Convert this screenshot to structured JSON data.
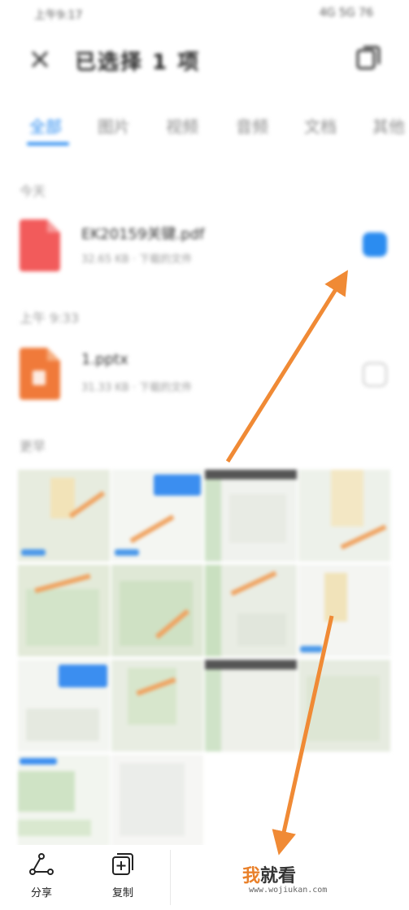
{
  "status_bar": {
    "left": "上午9:17",
    "right": "4G 5G 76"
  },
  "header": {
    "title": "已选择 1 项"
  },
  "tabs": [
    {
      "label": "全部",
      "active": true
    },
    {
      "label": "图片",
      "active": false
    },
    {
      "label": "视频",
      "active": false
    },
    {
      "label": "音频",
      "active": false
    },
    {
      "label": "文档",
      "active": false
    },
    {
      "label": "其他",
      "active": false
    }
  ],
  "sections": [
    {
      "label": "今天",
      "files": [
        {
          "name": "EK20159关键.pdf",
          "meta": "32.65 KB · 下载的文件",
          "checked": true,
          "icon": "pdf-icon",
          "color": "#f25b5b"
        }
      ]
    },
    {
      "label": "上午 9:33",
      "files": [
        {
          "name": "1.pptx",
          "meta": "31.33 KB · 下载的文件",
          "checked": false,
          "icon": "ppt-icon",
          "color": "#f07a3a"
        }
      ]
    },
    {
      "label": "更早"
    }
  ],
  "actions": [
    {
      "label": "分享",
      "icon": "share-icon"
    },
    {
      "label": "复制",
      "icon": "copy-icon"
    }
  ],
  "watermark": {
    "text_a": "我",
    "text_b": "就看",
    "url": "www.wojiukan.com"
  },
  "colors": {
    "accent": "#2b8cf0",
    "arrow": "#f08a35",
    "pdf": "#f25b5b",
    "ppt": "#f07a3a"
  }
}
